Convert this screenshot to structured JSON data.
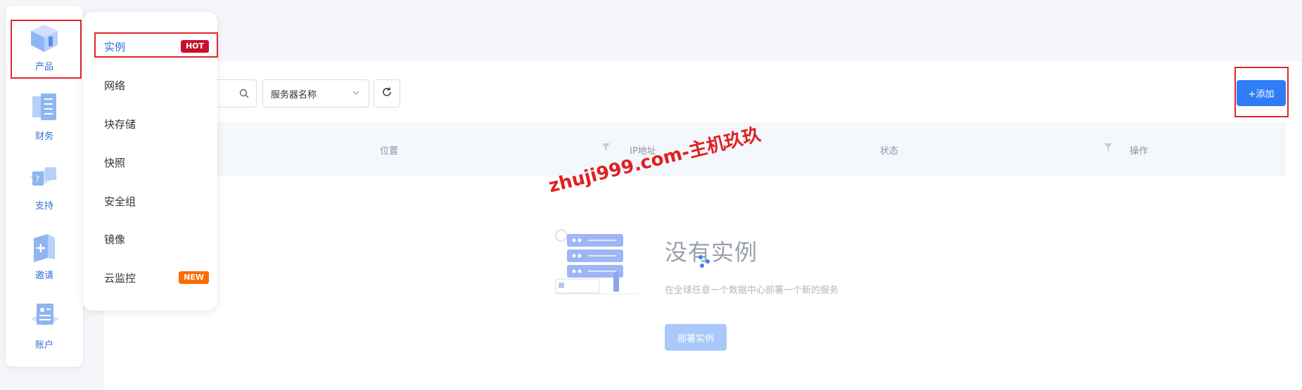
{
  "nav": {
    "items": [
      {
        "label": "产品",
        "icon": "product-icon"
      },
      {
        "label": "财务",
        "icon": "finance-icon"
      },
      {
        "label": "支持",
        "icon": "support-icon"
      },
      {
        "label": "邀请",
        "icon": "invite-icon"
      },
      {
        "label": "账户",
        "icon": "account-icon"
      }
    ]
  },
  "submenu": {
    "items": [
      {
        "label": "实例",
        "badge": "HOT"
      },
      {
        "label": "网络"
      },
      {
        "label": "块存储"
      },
      {
        "label": "快照"
      },
      {
        "label": "安全组"
      },
      {
        "label": "镜像"
      },
      {
        "label": "云监控",
        "badge": "NEW"
      }
    ]
  },
  "toolbar": {
    "select_value": "服务器名称",
    "add_label": "+添加"
  },
  "table": {
    "columns": [
      "位置",
      "IP地址",
      "状态",
      "操作"
    ]
  },
  "empty": {
    "title": "没有实例",
    "description": "在全球任意一个数据中心部署一个新的服务",
    "button": "部署实例"
  },
  "watermark": "zhuji999.com-主机玖玖",
  "colors": {
    "primary": "#2f7df6",
    "hot_badge": "#c8102e",
    "new_badge": "#ff6a00",
    "highlight_box": "#e0262c",
    "active_text": "#2f6fd6"
  }
}
